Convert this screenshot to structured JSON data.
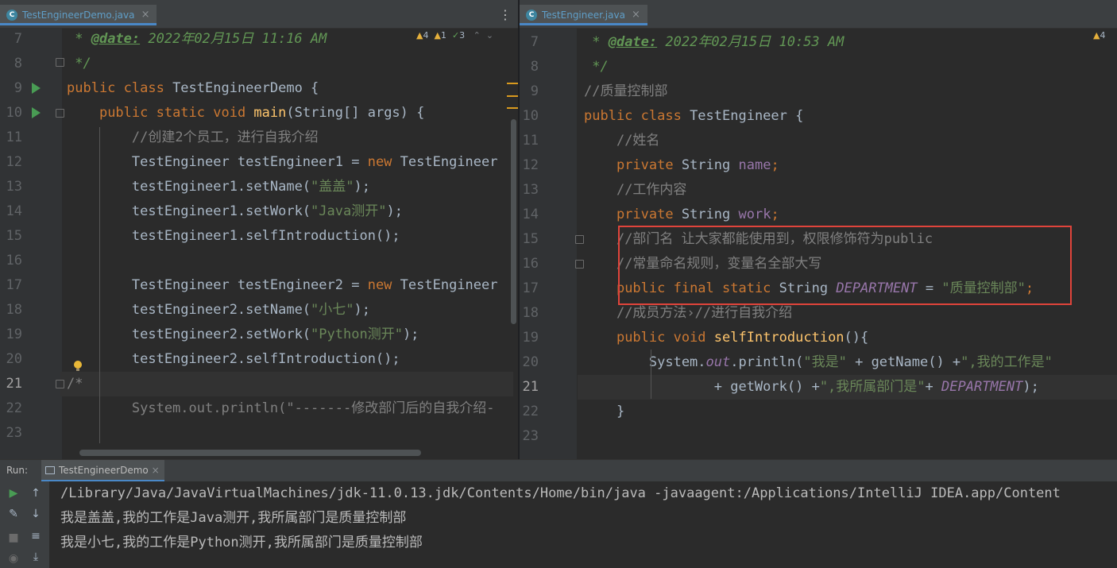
{
  "left_editor": {
    "tab": {
      "filename": "TestEngineerDemo.java",
      "icon": "C"
    },
    "inspections": {
      "warnings": "4",
      "weak_warnings": "1",
      "typos": "3"
    },
    "current_line": 21,
    "lines": [
      {
        "n": "7",
        "tokens": [
          [
            "doc",
            " * "
          ],
          [
            "tag",
            "@date:"
          ],
          [
            "doc",
            " 2022年02月15日 11:16 AM"
          ]
        ]
      },
      {
        "n": "8",
        "tokens": [
          [
            "doc",
            " */"
          ]
        ]
      },
      {
        "n": "9",
        "tokens": [
          [
            "kw",
            "public class "
          ],
          [
            "plain",
            "TestEngineerDemo {"
          ]
        ]
      },
      {
        "n": "10",
        "tokens": [
          [
            "plain",
            "    "
          ],
          [
            "kw",
            "public static void "
          ],
          [
            "fn",
            "main"
          ],
          [
            "plain",
            "(String[] args) {"
          ]
        ]
      },
      {
        "n": "11",
        "tokens": [
          [
            "plain",
            "        "
          ],
          [
            "cmt",
            "//创建2个员工，进行自我介绍"
          ]
        ]
      },
      {
        "n": "12",
        "tokens": [
          [
            "plain",
            "        TestEngineer testEngineer1 = "
          ],
          [
            "kw",
            "new "
          ],
          [
            "plain",
            "TestEngineer"
          ]
        ]
      },
      {
        "n": "13",
        "tokens": [
          [
            "plain",
            "        testEngineer1.setName("
          ],
          [
            "str",
            "\"盖盖\""
          ],
          [
            "plain",
            ");"
          ]
        ]
      },
      {
        "n": "14",
        "tokens": [
          [
            "plain",
            "        testEngineer1.setWork("
          ],
          [
            "str",
            "\"Java测开\""
          ],
          [
            "plain",
            ");"
          ]
        ]
      },
      {
        "n": "15",
        "tokens": [
          [
            "plain",
            "        testEngineer1.selfIntroduction();"
          ]
        ]
      },
      {
        "n": "16",
        "tokens": []
      },
      {
        "n": "17",
        "tokens": [
          [
            "plain",
            "        TestEngineer testEngineer2 = "
          ],
          [
            "kw",
            "new "
          ],
          [
            "plain",
            "TestEngineer"
          ]
        ]
      },
      {
        "n": "18",
        "tokens": [
          [
            "plain",
            "        testEngineer2.setName("
          ],
          [
            "str",
            "\"小七\""
          ],
          [
            "plain",
            ");"
          ]
        ]
      },
      {
        "n": "19",
        "tokens": [
          [
            "plain",
            "        testEngineer2.setWork("
          ],
          [
            "str",
            "\"Python测开\""
          ],
          [
            "plain",
            ");"
          ]
        ]
      },
      {
        "n": "20",
        "tokens": [
          [
            "plain",
            "        testEngineer2.selfIntroduction();"
          ]
        ]
      },
      {
        "n": "21",
        "tokens": [
          [
            "cmt",
            "/*"
          ]
        ]
      },
      {
        "n": "22",
        "tokens": [
          [
            "cmt",
            "        System.out.println(\"-------修改部门后的自我介绍-"
          ]
        ]
      },
      {
        "n": "23",
        "tokens": []
      }
    ]
  },
  "right_editor": {
    "tab": {
      "filename": "TestEngineer.java",
      "icon": "C"
    },
    "inspections": {
      "warnings": "4"
    },
    "current_line": 21,
    "lines": [
      {
        "n": "7",
        "tokens": [
          [
            "doc",
            " * "
          ],
          [
            "tag",
            "@date:"
          ],
          [
            "doc",
            " 2022年02月15日 10:53 AM"
          ]
        ]
      },
      {
        "n": "8",
        "tokens": [
          [
            "doc",
            " */"
          ]
        ]
      },
      {
        "n": "9",
        "tokens": [
          [
            "cmt",
            "//质量控制部"
          ]
        ]
      },
      {
        "n": "10",
        "tokens": [
          [
            "kw",
            "public class "
          ],
          [
            "plain",
            "TestEngineer {"
          ]
        ]
      },
      {
        "n": "11",
        "tokens": [
          [
            "plain",
            "    "
          ],
          [
            "cmt",
            "//姓名"
          ]
        ]
      },
      {
        "n": "12",
        "tokens": [
          [
            "plain",
            "    "
          ],
          [
            "kw",
            "private "
          ],
          [
            "plain",
            "String "
          ],
          [
            "field",
            "name"
          ],
          [
            "kw",
            ";"
          ]
        ]
      },
      {
        "n": "13",
        "tokens": [
          [
            "plain",
            "    "
          ],
          [
            "cmt",
            "//工作内容"
          ]
        ]
      },
      {
        "n": "14",
        "tokens": [
          [
            "plain",
            "    "
          ],
          [
            "kw",
            "private "
          ],
          [
            "plain",
            "String "
          ],
          [
            "field",
            "work"
          ],
          [
            "kw",
            ";"
          ]
        ]
      },
      {
        "n": "15",
        "tokens": [
          [
            "plain",
            "    "
          ],
          [
            "cmt",
            "//部门名 让大家都能使用到，权限修饰符为public"
          ]
        ]
      },
      {
        "n": "16",
        "tokens": [
          [
            "plain",
            "    "
          ],
          [
            "cmt",
            "//常量命名规则，变量名全部大写"
          ]
        ]
      },
      {
        "n": "17",
        "tokens": [
          [
            "plain",
            "    "
          ],
          [
            "kw",
            "public final static "
          ],
          [
            "plain",
            "String "
          ],
          [
            "sfield",
            "DEPARTMENT"
          ],
          [
            "plain",
            " = "
          ],
          [
            "str",
            "\"质量控制部\""
          ],
          [
            "kw",
            ";"
          ]
        ]
      },
      {
        "n": "18",
        "tokens": [
          [
            "plain",
            "    "
          ],
          [
            "cmt",
            "//成员方法›//进行自我介绍"
          ]
        ]
      },
      {
        "n": "19",
        "tokens": [
          [
            "plain",
            "    "
          ],
          [
            "kw",
            "public void "
          ],
          [
            "fn",
            "selfIntroduction"
          ],
          [
            "plain",
            "(){"
          ]
        ]
      },
      {
        "n": "20",
        "tokens": [
          [
            "plain",
            "        System."
          ],
          [
            "sref",
            "out"
          ],
          [
            "plain",
            ".println("
          ],
          [
            "str",
            "\"我是\""
          ],
          [
            "plain",
            " + getName() +"
          ],
          [
            "str",
            "\",我的工作是\""
          ]
        ]
      },
      {
        "n": "21",
        "tokens": [
          [
            "plain",
            "                + getWork() +"
          ],
          [
            "str",
            "\",我所属部门是\""
          ],
          [
            "plain",
            "+ "
          ],
          [
            "sfield",
            "DEPARTMENT"
          ],
          [
            "plain",
            ");"
          ]
        ]
      },
      {
        "n": "22",
        "tokens": [
          [
            "plain",
            "    }"
          ]
        ]
      },
      {
        "n": "23",
        "tokens": []
      }
    ]
  },
  "run_panel": {
    "label": "Run:",
    "tab": "TestEngineerDemo",
    "output": [
      "/Library/Java/JavaVirtualMachines/jdk-11.0.13.jdk/Contents/Home/bin/java -javaagent:/Applications/IntelliJ IDEA.app/Content",
      "我是盖盖,我的工作是Java测开,我所属部门是质量控制部",
      "我是小七,我的工作是Python测开,我所属部门是质量控制部"
    ]
  },
  "colors": {
    "background": "#2b2b2b",
    "keyword": "#cc7832",
    "string": "#6a8759",
    "comment": "#808080",
    "doc_comment": "#629755",
    "method": "#ffc66d",
    "field": "#9876aa",
    "highlight_box": "#e0443b",
    "run_icon": "#499c54"
  }
}
